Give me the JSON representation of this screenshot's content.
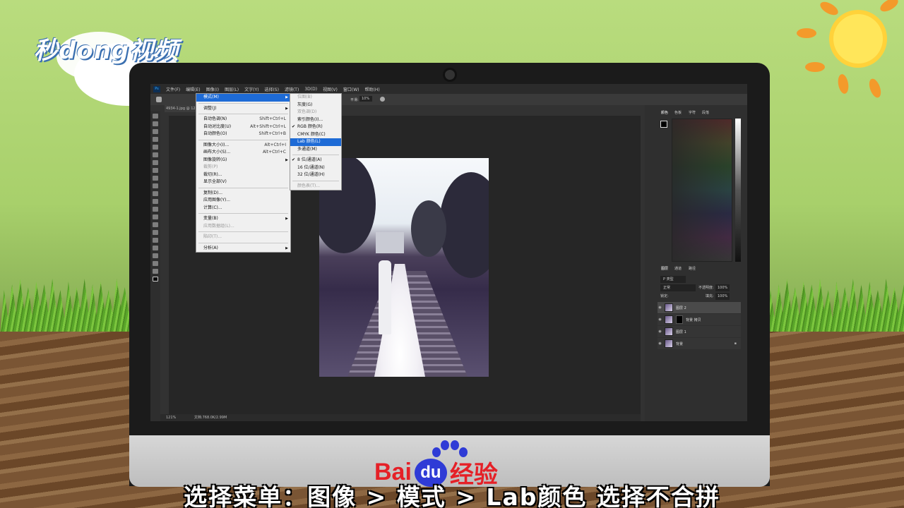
{
  "brand": {
    "logo_text": "秒dong视频"
  },
  "footer": {
    "brand_left": "Bai",
    "brand_du": "du",
    "brand_right": "经验"
  },
  "caption": "选择菜单：图像 > 模式 > Lab颜色 选择不合拼",
  "ps": {
    "app_icon": "Ps",
    "menubar": [
      "文件(F)",
      "编辑(E)",
      "图像(I)",
      "图层(L)",
      "文字(Y)",
      "选择(S)",
      "滤镜(T)",
      "3D(D)",
      "视图(V)",
      "窗口(W)",
      "帮助(H)"
    ],
    "options": {
      "flow_label": "平滑:",
      "flow_value": "10%"
    },
    "doc_tab": "4934-1.jpg @ 12",
    "status": {
      "zoom": "121%",
      "doc": "文档:768.0K/2.99M"
    },
    "panels": {
      "color_tabs": [
        "颜色",
        "色板",
        "字符",
        "段落"
      ],
      "layers_tabs": [
        "图层",
        "通道",
        "路径"
      ],
      "kind": "P 类型",
      "blend_mode": "正常",
      "opacity_label": "不透明度:",
      "opacity_value": "100%",
      "lock_label": "锁定:",
      "fill_label": "填充:",
      "fill_value": "100%",
      "layers": [
        {
          "name": "图层 2",
          "selected": true
        },
        {
          "name": "背景 拷贝",
          "mask": true
        },
        {
          "name": "图层 1"
        },
        {
          "name": "背景",
          "locked": true
        }
      ]
    },
    "image_menu": [
      {
        "label": "模式(M)",
        "highlight": true,
        "submenu": true
      },
      {
        "sep": true
      },
      {
        "label": "调整(J)",
        "submenu": true
      },
      {
        "sep": true
      },
      {
        "label": "自动色调(N)",
        "shortcut": "Shift+Ctrl+L"
      },
      {
        "label": "自动对比度(U)",
        "shortcut": "Alt+Shift+Ctrl+L"
      },
      {
        "label": "自动颜色(O)",
        "shortcut": "Shift+Ctrl+B"
      },
      {
        "sep": true
      },
      {
        "label": "图像大小(I)...",
        "shortcut": "Alt+Ctrl+I"
      },
      {
        "label": "画布大小(S)...",
        "shortcut": "Alt+Ctrl+C"
      },
      {
        "label": "图像旋转(G)",
        "submenu": true
      },
      {
        "label": "裁剪(P)",
        "disabled": true
      },
      {
        "label": "裁切(R)..."
      },
      {
        "label": "显示全部(V)"
      },
      {
        "sep": true
      },
      {
        "label": "复制(D)..."
      },
      {
        "label": "应用图像(Y)..."
      },
      {
        "label": "计算(C)..."
      },
      {
        "sep": true
      },
      {
        "label": "变量(B)",
        "submenu": true
      },
      {
        "label": "应用数据组(L)...",
        "disabled": true
      },
      {
        "sep": true
      },
      {
        "label": "陷印(T)...",
        "disabled": true
      },
      {
        "sep": true
      },
      {
        "label": "分析(A)",
        "submenu": true
      }
    ],
    "mode_menu": [
      {
        "label": "位图(B)",
        "disabled": true
      },
      {
        "label": "灰度(G)"
      },
      {
        "label": "双色调(D)",
        "disabled": true
      },
      {
        "label": "索引颜色(I)..."
      },
      {
        "label": "RGB 颜色(R)",
        "checked": true
      },
      {
        "label": "CMYK 颜色(C)"
      },
      {
        "label": "Lab 颜色(L)",
        "highlight": true
      },
      {
        "label": "多通道(M)"
      },
      {
        "sep": true
      },
      {
        "label": "8 位/通道(A)",
        "checked": true
      },
      {
        "label": "16 位/通道(N)"
      },
      {
        "label": "32 位/通道(H)"
      },
      {
        "sep": true
      },
      {
        "label": "颜色表(T)...",
        "disabled": true
      }
    ]
  }
}
